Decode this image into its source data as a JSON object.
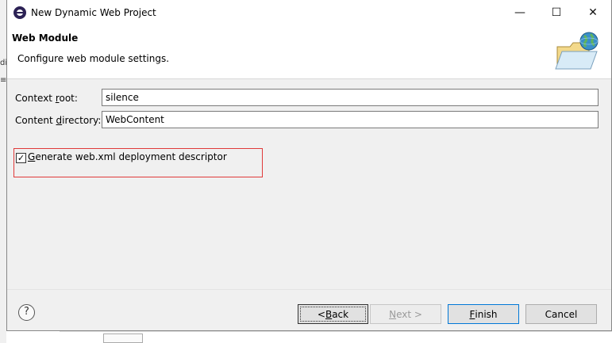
{
  "window": {
    "title": "New Dynamic Web Project",
    "minimize_glyph": "—",
    "maximize_glyph": "☐",
    "close_glyph": "✕"
  },
  "header": {
    "title": "Web Module",
    "description": "Configure web module settings."
  },
  "form": {
    "context_root": {
      "label_pre": "Context ",
      "label_mnemonic": "r",
      "label_post": "oot:",
      "value": "silence"
    },
    "content_directory": {
      "label_pre": "Content ",
      "label_mnemonic": "d",
      "label_post": "irectory:",
      "value": "WebContent"
    },
    "generate_descriptor": {
      "label_mnemonic": "G",
      "label_post": "enerate web.xml deployment descriptor",
      "checked": true,
      "check_glyph": "✓"
    }
  },
  "buttons": {
    "help_glyph": "?",
    "back": {
      "pre": "< ",
      "mnemonic": "B",
      "post": "ack"
    },
    "next": {
      "mnemonic": "N",
      "post": "ext >"
    },
    "finish": {
      "mnemonic": "F",
      "post": "inish"
    },
    "cancel": "Cancel"
  },
  "colors": {
    "highlight_border": "#e03a3a",
    "default_button_border": "#0078d7"
  },
  "icons": {
    "app": "eclipse-icon",
    "header_graphic": "web-project-folder-globe-icon",
    "help": "help-icon"
  }
}
